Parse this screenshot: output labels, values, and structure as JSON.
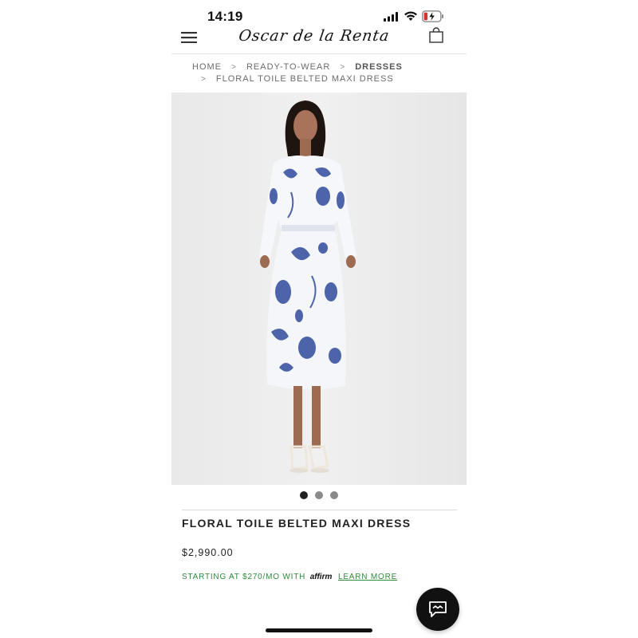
{
  "status_bar": {
    "time": "14:19"
  },
  "header": {
    "brand": "Oscar de la Renta",
    "menu_icon": "hamburger-icon",
    "bag_icon": "shopping-bag-icon"
  },
  "breadcrumb": {
    "items": [
      "HOME",
      "READY-TO-WEAR",
      "DRESSES",
      "FLORAL TOILE BELTED MAXI DRESS"
    ],
    "separator": ">"
  },
  "product": {
    "title": "FLORAL TOILE BELTED MAXI DRESS",
    "price": "$2,990.00",
    "image_count": 3,
    "active_image": 1
  },
  "financing": {
    "text": "STARTING AT $270/MO WITH",
    "provider": "affirm",
    "link": "LEARN MORE"
  },
  "colors": {
    "accent_green": "#2e8b3a",
    "print_blue": "#3b55a3",
    "dark": "#111111"
  },
  "chat": {
    "icon": "chat-icon"
  }
}
